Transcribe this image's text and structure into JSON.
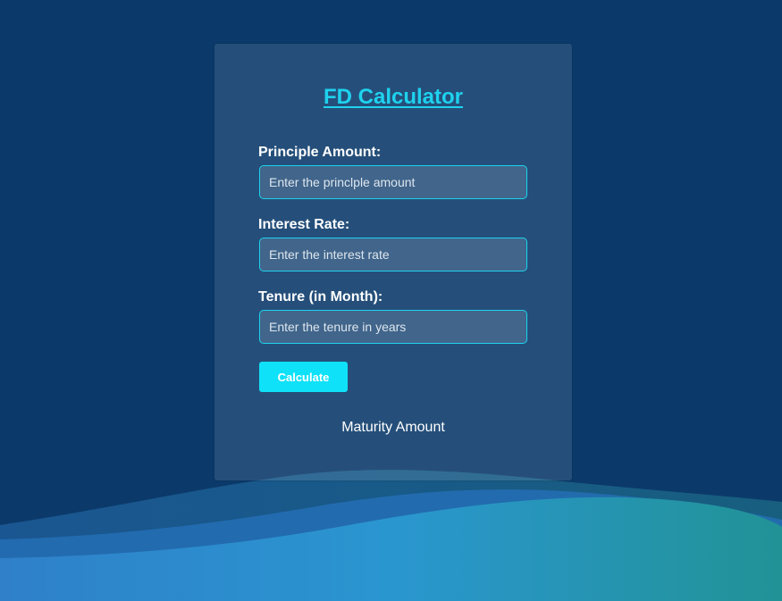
{
  "calculator": {
    "title": "FD Calculator",
    "principal": {
      "label": "Principle Amount:",
      "placeholder": "Enter the princlple amount",
      "value": ""
    },
    "interest": {
      "label": "Interest Rate:",
      "placeholder": "Enter the interest rate",
      "value": ""
    },
    "tenure": {
      "label": "Tenure (in Month):",
      "placeholder": "Enter the tenure in years",
      "value": ""
    },
    "calculate_label": "Calculate",
    "result_text": "Maturity Amount"
  },
  "colors": {
    "background": "#0b3a6a",
    "accent": "#1ed2ee",
    "button": "#0fe1f8",
    "wave_light": "#2a8fd6",
    "wave_teal": "#229a9e"
  }
}
